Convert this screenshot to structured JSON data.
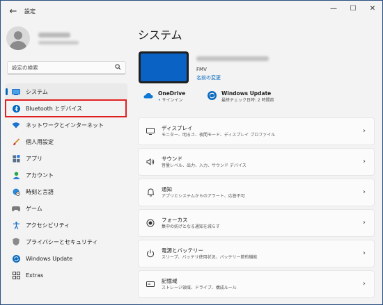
{
  "window": {
    "back_label": "←",
    "app_title": "設定",
    "controls": {
      "minimize": "—",
      "maximize": "☐",
      "close": "✕"
    }
  },
  "search": {
    "placeholder": "設定の検索",
    "icon": "search-icon"
  },
  "nav": {
    "items": [
      {
        "label": "システム",
        "icon": "system-icon",
        "selected": true
      },
      {
        "label": "Bluetooth とデバイス",
        "icon": "bluetooth-icon",
        "selected": false,
        "highlighted": true
      },
      {
        "label": "ネットワークとインターネット",
        "icon": "wifi-icon",
        "selected": false
      },
      {
        "label": "個人用設定",
        "icon": "brush-icon",
        "selected": false
      },
      {
        "label": "アプリ",
        "icon": "apps-icon",
        "selected": false
      },
      {
        "label": "アカウント",
        "icon": "account-icon",
        "selected": false
      },
      {
        "label": "時刻と言語",
        "icon": "globe-clock-icon",
        "selected": false
      },
      {
        "label": "ゲーム",
        "icon": "gamepad-icon",
        "selected": false
      },
      {
        "label": "アクセシビリティ",
        "icon": "accessibility-icon",
        "selected": false
      },
      {
        "label": "プライバシーとセキュリティ",
        "icon": "shield-icon",
        "selected": false
      },
      {
        "label": "Windows Update",
        "icon": "update-icon",
        "selected": false
      },
      {
        "label": "Extras",
        "icon": "extras-icon",
        "selected": false
      }
    ]
  },
  "main": {
    "title": "システム",
    "device": {
      "model": "FMV",
      "rename_link": "名前の変更"
    },
    "quick": [
      {
        "title": "OneDrive",
        "sub": "サインイン",
        "icon": "onedrive-icon"
      },
      {
        "title": "Windows Update",
        "sub": "最終チェック日時: 2 時間前",
        "icon": "update-icon"
      }
    ],
    "cards": [
      {
        "title": "ディスプレイ",
        "desc": "モニター、明るさ、夜間モード、ディスプレイ プロファイル",
        "icon": "display-icon"
      },
      {
        "title": "サウンド",
        "desc": "音量レベル、出力、入力、サウンド デバイス",
        "icon": "speaker-icon"
      },
      {
        "title": "通知",
        "desc": "アプリとシステムからのアラート、応答不可",
        "icon": "bell-icon"
      },
      {
        "title": "フォーカス",
        "desc": "集中の妨げとなる通知を減らす",
        "icon": "focus-icon"
      },
      {
        "title": "電源とバッテリー",
        "desc": "スリープ、バッテリ使用状況、バッテリー節約機能",
        "icon": "power-icon"
      },
      {
        "title": "記憶域",
        "desc": "ストレージ領域、ドライブ、構成ルール",
        "icon": "storage-icon"
      }
    ],
    "chevron": "›"
  }
}
